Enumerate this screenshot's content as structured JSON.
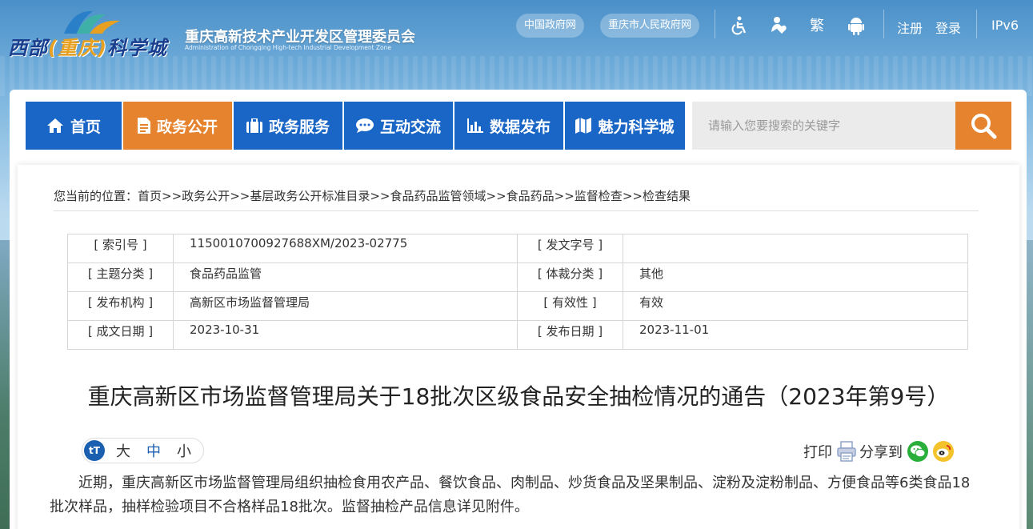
{
  "header": {
    "logo_text_a": "西部",
    "logo_text_b": "(",
    "logo_text_c": "重庆",
    "logo_text_d": ")",
    "logo_text_e": "科学城",
    "title": "重庆高新技术产业开发区管理委员会",
    "subtitle": "Administration of Chongqing High-tech Industrial Development Zone",
    "links": {
      "gov_cn": "中国政府网",
      "cq_gov": "重庆市人民政府网",
      "traditional": "繁",
      "register": "注册",
      "login": "登录",
      "ipv6": "IPv6"
    },
    "icons": [
      "accessibility-icon",
      "elderly-care-icon",
      "android-icon"
    ]
  },
  "nav": {
    "items": [
      {
        "label": "首页",
        "icon": "home-icon"
      },
      {
        "label": "政务公开",
        "icon": "document-icon",
        "active": true
      },
      {
        "label": "政务服务",
        "icon": "briefcase-icon"
      },
      {
        "label": "互动交流",
        "icon": "chat-icon"
      },
      {
        "label": "数据发布",
        "icon": "bar-chart-icon"
      },
      {
        "label": "魅力科学城",
        "icon": "map-icon"
      }
    ],
    "search_placeholder": "请输入您要搜索的关键字"
  },
  "breadcrumb": {
    "prefix": "您当前的位置：",
    "items": [
      "首页",
      "政务公开",
      "基层政务公开标准目录",
      "食品药品监管领域",
      "食品药品",
      "监督检查",
      "检查结果"
    ],
    "separator": ">>"
  },
  "meta": {
    "rows": [
      {
        "l1": "[ 索引号 ]",
        "v1": "1150010700927688XM/2023-02775",
        "l2": "[ 发文字号 ]",
        "v2": ""
      },
      {
        "l1": "[ 主题分类 ]",
        "v1": "食品药品监管",
        "l2": "[ 体裁分类 ]",
        "v2": "其他"
      },
      {
        "l1": "[ 发布机构 ]",
        "v1": "高新区市场监督管理局",
        "l2": "[ 有效性 ]",
        "v2": "有效"
      },
      {
        "l1": "[ 成文日期 ]",
        "v1": "2023-10-31",
        "l2": "[ 发布日期 ]",
        "v2": "2023-11-01"
      }
    ]
  },
  "article": {
    "title": "重庆高新区市场监督管理局关于18批次区级食品安全抽检情况的通告（2023年第9号）",
    "font_size": {
      "big": "大",
      "mid": "中",
      "small": "小"
    },
    "print": "打印",
    "share": "分享到",
    "body": "近期，重庆高新区市场监督管理局组织抽检食用农产品、餐饮食品、肉制品、炒货食品及坚果制品、淀粉及淀粉制品、方便食品等6类食品18批次样品，抽样检验项目不合格样品18批次。监督抽检产品信息详见附件。"
  },
  "colors": {
    "nav_blue": "#1a66c6",
    "nav_active": "#e6832e",
    "search_btn": "#e6832e"
  }
}
